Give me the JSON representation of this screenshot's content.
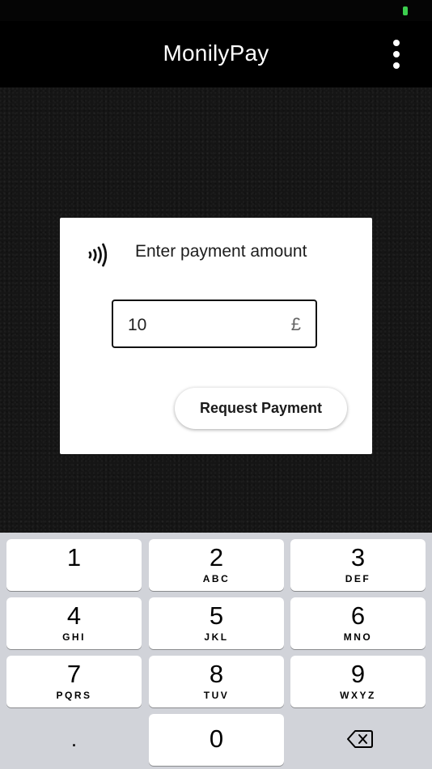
{
  "app": {
    "title": "MonilyPay",
    "menu_icon": "more-vertical-icon"
  },
  "status_bar": {
    "battery_color": "#3ccf4e"
  },
  "payment": {
    "icon": "contactless-icon",
    "title": "Enter payment amount",
    "amount_value": "10",
    "currency_symbol": "£",
    "request_button_label": "Request Payment"
  },
  "keypad": {
    "keys": [
      {
        "digit": "1",
        "letters": ""
      },
      {
        "digit": "2",
        "letters": "ABC"
      },
      {
        "digit": "3",
        "letters": "DEF"
      },
      {
        "digit": "4",
        "letters": "GHI"
      },
      {
        "digit": "5",
        "letters": "JKL"
      },
      {
        "digit": "6",
        "letters": "MNO"
      },
      {
        "digit": "7",
        "letters": "PQRS"
      },
      {
        "digit": "8",
        "letters": "TUV"
      },
      {
        "digit": "9",
        "letters": "WXYZ"
      },
      {
        "digit": ".",
        "letters": ""
      },
      {
        "digit": "0",
        "letters": ""
      }
    ],
    "backspace_icon": "backspace-icon"
  }
}
